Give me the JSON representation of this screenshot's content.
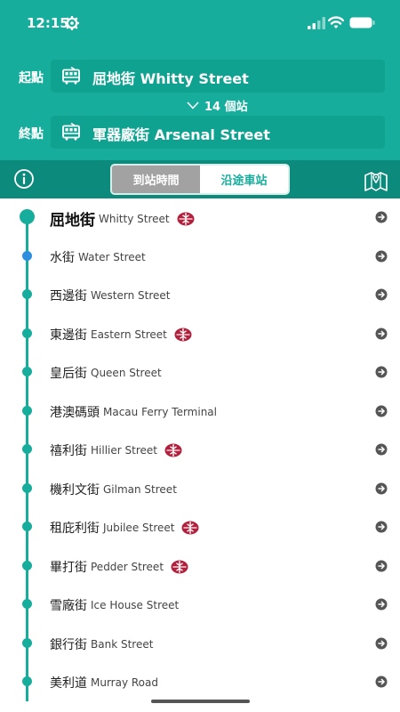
{
  "status_bar": {
    "time": "12:15"
  },
  "route": {
    "origin_label": "起點",
    "origin_value": "屈地街 Whitty Street",
    "stops_toggle": "14 個站",
    "destination_label": "終點",
    "destination_value": "軍器廠街 Arsenal Street"
  },
  "toolbar": {
    "tabs": [
      {
        "label": "到站時間",
        "active": false
      },
      {
        "label": "沿途車站",
        "active": true
      }
    ]
  },
  "stops": [
    {
      "zh": "屈地街",
      "en": "Whitty Street",
      "mtr": true
    },
    {
      "zh": "水街",
      "en": "Water Street",
      "mtr": false
    },
    {
      "zh": "西邊街",
      "en": "Western Street",
      "mtr": false
    },
    {
      "zh": "東邊街",
      "en": "Eastern Street",
      "mtr": true
    },
    {
      "zh": "皇后街",
      "en": "Queen Street",
      "mtr": false
    },
    {
      "zh": "港澳碼頭",
      "en": "Macau Ferry Terminal",
      "mtr": false
    },
    {
      "zh": "禧利街",
      "en": "Hillier Street",
      "mtr": true
    },
    {
      "zh": "機利文街",
      "en": "Gilman Street",
      "mtr": false
    },
    {
      "zh": "租庇利街",
      "en": "Jubilee Street",
      "mtr": true
    },
    {
      "zh": "畢打街",
      "en": "Pedder Street",
      "mtr": true
    },
    {
      "zh": "雪廠街",
      "en": "Ice House Street",
      "mtr": false
    },
    {
      "zh": "銀行街",
      "en": "Bank Street",
      "mtr": false
    },
    {
      "zh": "美利道",
      "en": "Murray Road",
      "mtr": false
    }
  ],
  "icons": {
    "settings": "gear-icon",
    "signal": "cellular-signal-icon",
    "wifi": "wifi-icon",
    "battery": "battery-icon",
    "tram": "tram-icon",
    "info": "info-icon",
    "map": "map-icon",
    "mtr": "mtr-logo-icon",
    "stop_arrow": "arrow-right-circle-icon"
  },
  "colors": {
    "header": "#17ad9c",
    "toolbar": "#0c8a7b",
    "timeline": "#17ad9c",
    "current_dot": "#2e8fe0",
    "mtr": "#b1203c"
  }
}
